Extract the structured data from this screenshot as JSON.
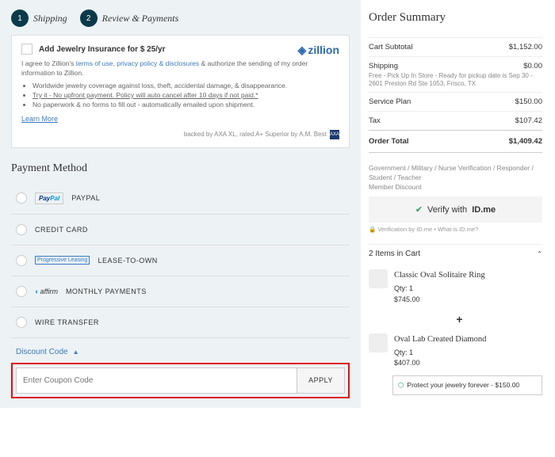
{
  "steps": [
    {
      "num": "1",
      "label": "Shipping"
    },
    {
      "num": "2",
      "label": "Review & Payments"
    }
  ],
  "insurance": {
    "title": "Add Jewelry Insurance for $ 25/yr",
    "logo": "zillion",
    "agree_prefix": "I agree to Zillion's ",
    "terms": "terms of use",
    "comma1": ", ",
    "privacy": "privacy policy & disclosures",
    "agree_suffix": " & authorize the sending of my order information to Zillion.",
    "bullets": [
      "Worldwide jewelry coverage against loss, theft, accidental damage, & disappearance.",
      "Try it - No upfront payment. Policy will auto cancel after 10 days if not paid.*",
      "No paperwork & no forms to fill out - automatically emailed upon shipment."
    ],
    "learn": "Learn More",
    "backed": "backed by AXA XL, rated A+ Superior by A.M. Best",
    "axa": "AXA"
  },
  "payment": {
    "title": "Payment Method",
    "options": [
      {
        "key": "paypal",
        "label": "PAYPAL"
      },
      {
        "key": "credit",
        "label": "CREDIT CARD"
      },
      {
        "key": "lease",
        "label": "LEASE-TO-OWN",
        "badge": "Progressive Leasing"
      },
      {
        "key": "monthly",
        "label": "MONTHLY PAYMENTS",
        "badge": "affirm"
      },
      {
        "key": "wire",
        "label": "WIRE TRANSFER"
      }
    ],
    "discount_label": "Discount Code",
    "coupon_placeholder": "Enter Coupon Code",
    "apply_label": "APPLY"
  },
  "summary": {
    "title": "Order Summary",
    "rows": [
      {
        "label": "Cart Subtotal",
        "value": "$1,152.00"
      },
      {
        "label": "Shipping",
        "value": "$0.00"
      },
      {
        "label": "Service Plan",
        "value": "$150.00"
      },
      {
        "label": "Tax",
        "value": "$107.42"
      }
    ],
    "shipping_note": "Free - Pick Up In Store - Ready for pickup date is Sep 30 - 2601 Preston Rd Ste 1053, Frisco, TX",
    "total_label": "Order Total",
    "total_value": "$1,409.42",
    "verify_note": "Government / Military / Nurse Verification / Responder / Student / Teacher\nMember Discount",
    "verify_btn": "Verify with",
    "idme": "ID.me",
    "verify_small": "🔒 Verification by ID.me • What is ID.me?",
    "cart_count": "2 Items in Cart",
    "items": [
      {
        "name": "Classic Oval Solitaire Ring",
        "qty": "Qty: 1",
        "price": "$745.00"
      },
      {
        "name": "Oval Lab Created Diamond",
        "qty": "Qty: 1",
        "price": "$407.00"
      }
    ],
    "protect": "Protect your jewelry forever - $150.00"
  }
}
